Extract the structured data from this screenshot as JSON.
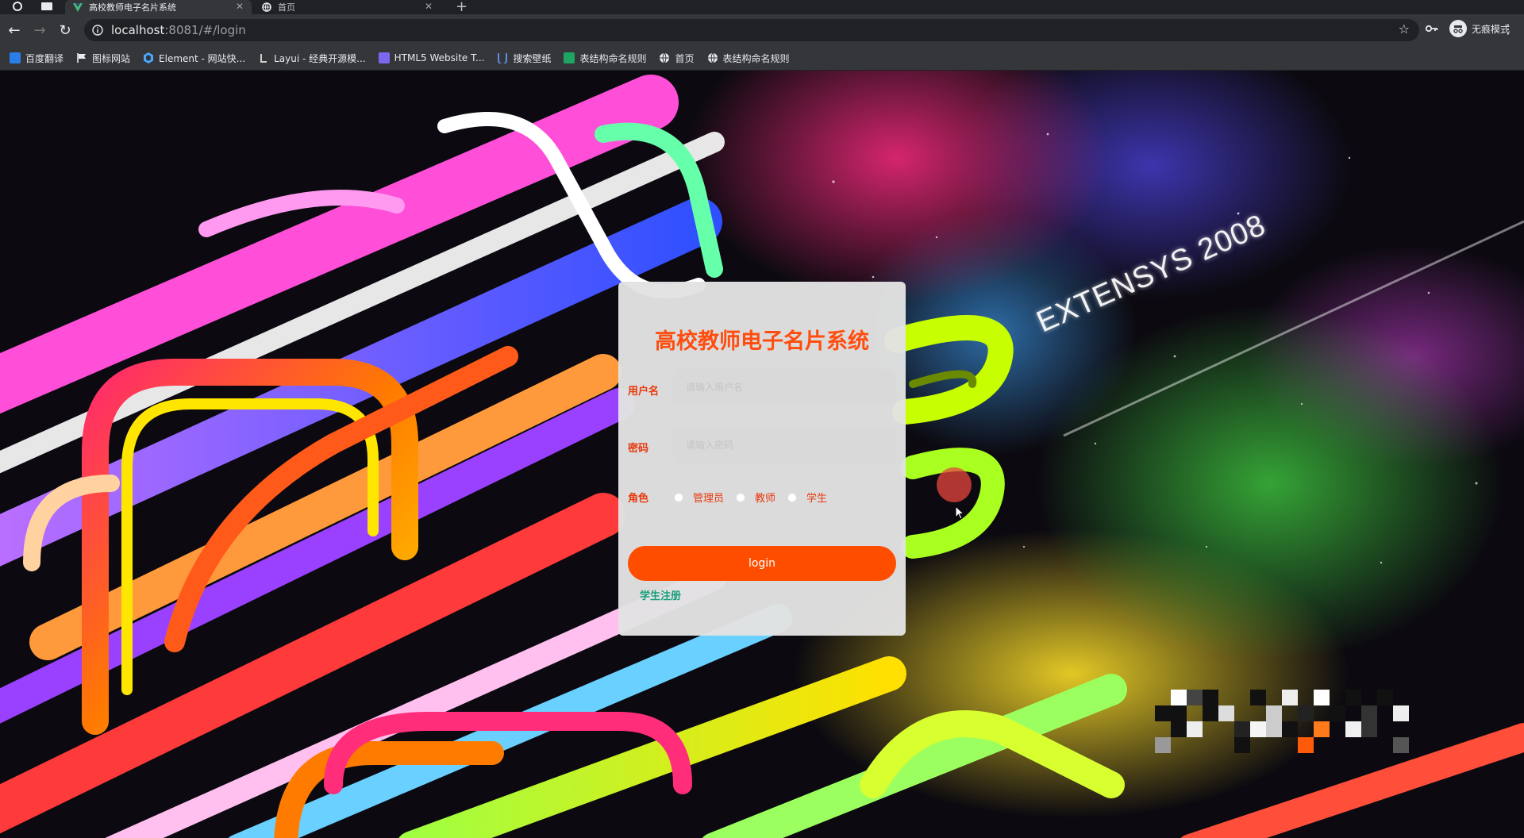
{
  "browser": {
    "tabs": [
      {
        "title": "高校教师电子名片系统",
        "active": true
      },
      {
        "title": "首页",
        "active": false
      }
    ],
    "url_host": "localhost",
    "url_path": ":8081/#/login",
    "incognito_label": "无痕模式",
    "bookmarks": [
      {
        "label": "百度翻译",
        "icon": "translate-icon",
        "color": "#2b7de9"
      },
      {
        "label": "图标网站",
        "icon": "flag-icon",
        "color": "#e8eaed"
      },
      {
        "label": "Element - 网站快...",
        "icon": "element-icon",
        "color": "#4aa8ff"
      },
      {
        "label": "Layui - 经典开源模...",
        "icon": "layui-icon",
        "color": "#cfcfcf"
      },
      {
        "label": "HTML5 Website T...",
        "icon": "html5-icon",
        "color": "#7b68ee"
      },
      {
        "label": "搜索壁纸",
        "icon": "wallpaper-icon",
        "color": "#5c8ee6"
      },
      {
        "label": "表结构命名规则",
        "icon": "sheet-icon",
        "color": "#1fa463"
      },
      {
        "label": "首页",
        "icon": "globe-icon",
        "color": "#e8eaed"
      },
      {
        "label": "表结构命名规则",
        "icon": "globe-icon",
        "color": "#e8eaed"
      }
    ]
  },
  "background": {
    "watermark": "EXTENSYS 2008"
  },
  "login": {
    "title": "高校教师电子名片系统",
    "username_label": "用户名",
    "username_placeholder": "请输入用户名",
    "password_label": "密码",
    "password_placeholder": "请输入密码",
    "role_label": "角色",
    "roles": [
      "管理员",
      "教师",
      "学生"
    ],
    "login_button": "login",
    "register_link": "学生注册"
  },
  "colors": {
    "accent": "#ff4d00",
    "title": "#ff4d0f",
    "label": "#e8380d",
    "link": "#1a9e7b"
  }
}
